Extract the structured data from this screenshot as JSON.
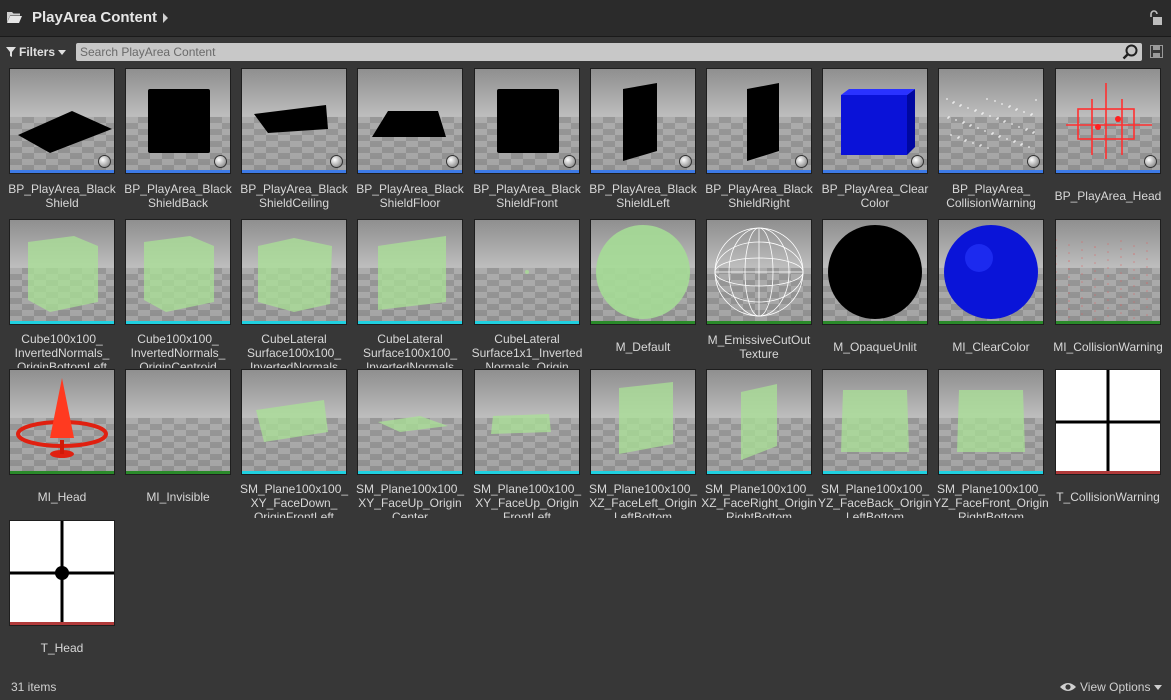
{
  "header": {
    "title": "PlayArea Content"
  },
  "toolbar": {
    "filters_label": "Filters",
    "search_placeholder": "Search PlayArea Content"
  },
  "colors": {
    "blueprint": "#3d7ae6",
    "material": "#2a8a2a",
    "mesh": "#20d0e0",
    "texture": "#b03a3a"
  },
  "assets": [
    {
      "name": "BP_PlayArea_BlackShield",
      "lines": [
        "BP_PlayArea_Black",
        "Shield"
      ],
      "type": "blueprint",
      "thumb": "black-plane-flat"
    },
    {
      "name": "BP_PlayArea_BlackShieldBack",
      "lines": [
        "BP_PlayArea_Black",
        "ShieldBack"
      ],
      "type": "blueprint",
      "thumb": "black-square"
    },
    {
      "name": "BP_PlayArea_BlackShieldCeiling",
      "lines": [
        "BP_PlayArea_Black",
        "ShieldCeiling"
      ],
      "type": "blueprint",
      "thumb": "black-plane-tilt"
    },
    {
      "name": "BP_PlayArea_BlackShieldFloor",
      "lines": [
        "BP_PlayArea_Black",
        "ShieldFloor"
      ],
      "type": "blueprint",
      "thumb": "black-trapezoid"
    },
    {
      "name": "BP_PlayArea_BlackShieldFront",
      "lines": [
        "BP_PlayArea_Black",
        "ShieldFront"
      ],
      "type": "blueprint",
      "thumb": "black-square"
    },
    {
      "name": "BP_PlayArea_BlackShieldLeft",
      "lines": [
        "BP_PlayArea_Black",
        "ShieldLeft"
      ],
      "type": "blueprint",
      "thumb": "black-wall-left"
    },
    {
      "name": "BP_PlayArea_BlackShieldRight",
      "lines": [
        "BP_PlayArea_Black",
        "ShieldRight"
      ],
      "type": "blueprint",
      "thumb": "black-wall-right"
    },
    {
      "name": "BP_PlayArea_ClearColor",
      "lines": [
        "BP_PlayArea_Clear",
        "Color"
      ],
      "type": "blueprint",
      "thumb": "blue-cube"
    },
    {
      "name": "BP_PlayArea_CollisionWarning",
      "lines": [
        "BP_PlayArea_",
        "CollisionWarning"
      ],
      "type": "blueprint",
      "thumb": "dots-field"
    },
    {
      "name": "BP_PlayArea_Head",
      "lines": [
        "BP_PlayArea_Head"
      ],
      "type": "blueprint",
      "thumb": "red-crosshair"
    },
    {
      "name": "Cube100x100_InvertedNormals_OriginBottomLeft",
      "lines": [
        "Cube100x100_",
        "InvertedNormals_",
        "OriginBottomLeft"
      ],
      "type": "mesh",
      "thumb": "green-cube"
    },
    {
      "name": "Cube100x100_InvertedNormals_OriginCentroid",
      "lines": [
        "Cube100x100_",
        "InvertedNormals_",
        "OriginCentroid"
      ],
      "type": "mesh",
      "thumb": "green-cube"
    },
    {
      "name": "CubeLateralSurface100x100_InvertedNormals",
      "lines": [
        "CubeLateral",
        "Surface100x100_",
        "InvertedNormals"
      ],
      "type": "mesh",
      "thumb": "green-cube-open"
    },
    {
      "name": "CubeLateralSurface100x100_InvertedNormals_2",
      "lines": [
        "CubeLateral",
        "Surface100x100_",
        "InvertedNormals"
      ],
      "type": "mesh",
      "thumb": "green-wall"
    },
    {
      "name": "CubeLateralSurface1x1_InvertedNormals_Origin",
      "lines": [
        "CubeLateral",
        "Surface1x1_Inverted",
        "Normals_Origin"
      ],
      "type": "mesh",
      "thumb": "empty-floor"
    },
    {
      "name": "M_Default",
      "lines": [
        "M_Default"
      ],
      "type": "material",
      "thumb": "green-sphere"
    },
    {
      "name": "M_EmissiveCutOutTexture",
      "lines": [
        "M_EmissiveCutOut",
        "Texture"
      ],
      "type": "material",
      "thumb": "wire-sphere"
    },
    {
      "name": "M_OpaqueUnlit",
      "lines": [
        "M_OpaqueUnlit"
      ],
      "type": "material",
      "thumb": "black-sphere"
    },
    {
      "name": "MI_ClearColor",
      "lines": [
        "MI_ClearColor"
      ],
      "type": "material",
      "thumb": "blue-sphere"
    },
    {
      "name": "MI_CollisionWarning",
      "lines": [
        "MI_CollisionWarning"
      ],
      "type": "material",
      "thumb": "noise-floor"
    },
    {
      "name": "MI_Head",
      "lines": [
        "MI_Head"
      ],
      "type": "material",
      "thumb": "red-gizmo"
    },
    {
      "name": "MI_Invisible",
      "lines": [
        "MI_Invisible"
      ],
      "type": "material",
      "thumb": "checker-only"
    },
    {
      "name": "SM_Plane100x100_XY_FaceDown_OriginFrontLeft",
      "lines": [
        "SM_Plane100x100_",
        "XY_FaceDown_",
        "OriginFrontLeft"
      ],
      "type": "mesh",
      "thumb": "green-plane-big"
    },
    {
      "name": "SM_Plane100x100_XY_FaceUp_OriginCenter",
      "lines": [
        "SM_Plane100x100_",
        "XY_FaceUp_Origin",
        "Center"
      ],
      "type": "mesh",
      "thumb": "green-plane-flat"
    },
    {
      "name": "SM_Plane100x100_XY_FaceUp_OriginFrontLeft",
      "lines": [
        "SM_Plane100x100_",
        "XY_FaceUp_Origin",
        "FrontLeft"
      ],
      "type": "mesh",
      "thumb": "green-plane-flat2"
    },
    {
      "name": "SM_Plane100x100_XZ_FaceLeft_OriginLeftBottom",
      "lines": [
        "SM_Plane100x100_",
        "XZ_FaceLeft_Origin",
        "LeftBottom"
      ],
      "type": "mesh",
      "thumb": "green-wall-left"
    },
    {
      "name": "SM_Plane100x100_XZ_FaceRight_OriginRightBottom",
      "lines": [
        "SM_Plane100x100_",
        "XZ_FaceRight_Origin",
        "RightBottom"
      ],
      "type": "mesh",
      "thumb": "green-wall-right"
    },
    {
      "name": "SM_Plane100x100_YZ_FaceBack_OriginLeftBottom",
      "lines": [
        "SM_Plane100x100_",
        "YZ_FaceBack_Origin",
        "LeftBottom"
      ],
      "type": "mesh",
      "thumb": "green-square"
    },
    {
      "name": "SM_Plane100x100_YZ_FaceFront_OriginRightBottom",
      "lines": [
        "SM_Plane100x100_",
        "YZ_FaceFront_Origin",
        "RightBottom"
      ],
      "type": "mesh",
      "thumb": "green-square"
    },
    {
      "name": "T_CollisionWarning",
      "lines": [
        "T_CollisionWarning"
      ],
      "type": "texture",
      "thumb": "cross-white"
    },
    {
      "name": "T_Head",
      "lines": [
        "T_Head"
      ],
      "type": "texture",
      "thumb": "cross-white-dot"
    }
  ],
  "footer": {
    "count": "31 items",
    "view_options_label": "View Options"
  }
}
